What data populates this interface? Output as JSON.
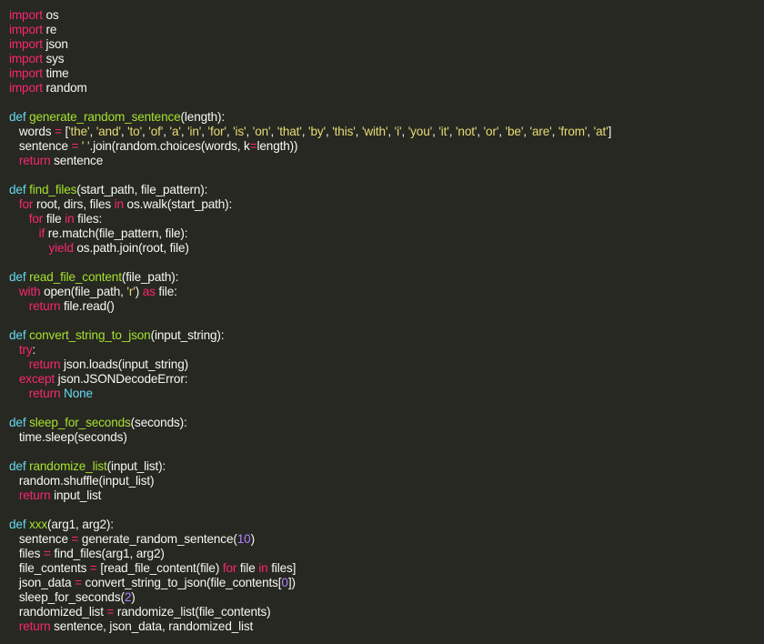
{
  "editor": {
    "theme_colors": {
      "background": "#272822",
      "text": "#f8f8f2",
      "keyword": "#f92672",
      "definition": "#66d9ef",
      "function_name": "#a6e22e",
      "string": "#e6db74",
      "number": "#ae81ff"
    },
    "lines": [
      [
        [
          "kw",
          "import"
        ],
        [
          "p",
          " os"
        ]
      ],
      [
        [
          "kw",
          "import"
        ],
        [
          "p",
          " re"
        ]
      ],
      [
        [
          "kw",
          "import"
        ],
        [
          "p",
          " json"
        ]
      ],
      [
        [
          "kw",
          "import"
        ],
        [
          "p",
          " sys"
        ]
      ],
      [
        [
          "kw",
          "import"
        ],
        [
          "p",
          " time"
        ]
      ],
      [
        [
          "kw",
          "import"
        ],
        [
          "p",
          " random"
        ]
      ],
      [],
      [
        [
          "def",
          "def"
        ],
        [
          "p",
          " "
        ],
        [
          "fn",
          "generate_random_sentence"
        ],
        [
          "p",
          "(length):"
        ]
      ],
      [
        [
          "p",
          "   words "
        ],
        [
          "kw",
          "="
        ],
        [
          "p",
          " ["
        ],
        [
          "str",
          "'the'"
        ],
        [
          "p",
          ", "
        ],
        [
          "str",
          "'and'"
        ],
        [
          "p",
          ", "
        ],
        [
          "str",
          "'to'"
        ],
        [
          "p",
          ", "
        ],
        [
          "str",
          "'of'"
        ],
        [
          "p",
          ", "
        ],
        [
          "str",
          "'a'"
        ],
        [
          "p",
          ", "
        ],
        [
          "str",
          "'in'"
        ],
        [
          "p",
          ", "
        ],
        [
          "str",
          "'for'"
        ],
        [
          "p",
          ", "
        ],
        [
          "str",
          "'is'"
        ],
        [
          "p",
          ", "
        ],
        [
          "str",
          "'on'"
        ],
        [
          "p",
          ", "
        ],
        [
          "str",
          "'that'"
        ],
        [
          "p",
          ", "
        ],
        [
          "str",
          "'by'"
        ],
        [
          "p",
          ", "
        ],
        [
          "str",
          "'this'"
        ],
        [
          "p",
          ", "
        ],
        [
          "str",
          "'with'"
        ],
        [
          "p",
          ", "
        ],
        [
          "str",
          "'i'"
        ],
        [
          "p",
          ", "
        ],
        [
          "str",
          "'you'"
        ],
        [
          "p",
          ", "
        ],
        [
          "str",
          "'it'"
        ],
        [
          "p",
          ", "
        ],
        [
          "str",
          "'not'"
        ],
        [
          "p",
          ", "
        ],
        [
          "str",
          "'or'"
        ],
        [
          "p",
          ", "
        ],
        [
          "str",
          "'be'"
        ],
        [
          "p",
          ", "
        ],
        [
          "str",
          "'are'"
        ],
        [
          "p",
          ", "
        ],
        [
          "str",
          "'from'"
        ],
        [
          "p",
          ", "
        ],
        [
          "str",
          "'at'"
        ],
        [
          "p",
          "]"
        ]
      ],
      [
        [
          "p",
          "   sentence "
        ],
        [
          "kw",
          "="
        ],
        [
          "p",
          " "
        ],
        [
          "str",
          "' '"
        ],
        [
          "p",
          "."
        ],
        [
          "p",
          "join(random"
        ],
        [
          "p",
          "."
        ],
        [
          "p",
          "choices(words, k"
        ],
        [
          "kw",
          "="
        ],
        [
          "p",
          "length))"
        ]
      ],
      [
        [
          "p",
          "   "
        ],
        [
          "kw",
          "return"
        ],
        [
          "p",
          " sentence"
        ]
      ],
      [],
      [
        [
          "def",
          "def"
        ],
        [
          "p",
          " "
        ],
        [
          "fn",
          "find_files"
        ],
        [
          "p",
          "(start_path, file_pattern):"
        ]
      ],
      [
        [
          "p",
          "   "
        ],
        [
          "kw",
          "for"
        ],
        [
          "p",
          " root, dirs, files "
        ],
        [
          "kw",
          "in"
        ],
        [
          "p",
          " os"
        ],
        [
          "p",
          "."
        ],
        [
          "p",
          "walk(start_path):"
        ]
      ],
      [
        [
          "p",
          "      "
        ],
        [
          "kw",
          "for"
        ],
        [
          "p",
          " file "
        ],
        [
          "kw",
          "in"
        ],
        [
          "p",
          " files:"
        ]
      ],
      [
        [
          "p",
          "         "
        ],
        [
          "kw",
          "if"
        ],
        [
          "p",
          " re"
        ],
        [
          "p",
          "."
        ],
        [
          "p",
          "match(file_pattern, file):"
        ]
      ],
      [
        [
          "p",
          "            "
        ],
        [
          "kw",
          "yield"
        ],
        [
          "p",
          " os"
        ],
        [
          "p",
          "."
        ],
        [
          "p",
          "path"
        ],
        [
          "p",
          "."
        ],
        [
          "p",
          "join(root, file)"
        ]
      ],
      [],
      [
        [
          "def",
          "def"
        ],
        [
          "p",
          " "
        ],
        [
          "fn",
          "read_file_content"
        ],
        [
          "p",
          "(file_path):"
        ]
      ],
      [
        [
          "p",
          "   "
        ],
        [
          "kw",
          "with"
        ],
        [
          "p",
          " open(file_path, "
        ],
        [
          "str",
          "'r'"
        ],
        [
          "p",
          ") "
        ],
        [
          "kw",
          "as"
        ],
        [
          "p",
          " file:"
        ]
      ],
      [
        [
          "p",
          "      "
        ],
        [
          "kw",
          "return"
        ],
        [
          "p",
          " file"
        ],
        [
          "p",
          "."
        ],
        [
          "p",
          "read()"
        ]
      ],
      [],
      [
        [
          "def",
          "def"
        ],
        [
          "p",
          " "
        ],
        [
          "fn",
          "convert_string_to_json"
        ],
        [
          "p",
          "(input_string):"
        ]
      ],
      [
        [
          "p",
          "   "
        ],
        [
          "kw",
          "try"
        ],
        [
          "p",
          ":"
        ]
      ],
      [
        [
          "p",
          "      "
        ],
        [
          "kw",
          "return"
        ],
        [
          "p",
          " json"
        ],
        [
          "p",
          "."
        ],
        [
          "p",
          "loads(input_string)"
        ]
      ],
      [
        [
          "p",
          "   "
        ],
        [
          "kw",
          "except"
        ],
        [
          "p",
          " json"
        ],
        [
          "p",
          "."
        ],
        [
          "p",
          "JSONDecodeError:"
        ]
      ],
      [
        [
          "p",
          "      "
        ],
        [
          "kw",
          "return"
        ],
        [
          "p",
          " "
        ],
        [
          "def",
          "None"
        ]
      ],
      [],
      [
        [
          "def",
          "def"
        ],
        [
          "p",
          " "
        ],
        [
          "fn",
          "sleep_for_seconds"
        ],
        [
          "p",
          "(seconds):"
        ]
      ],
      [
        [
          "p",
          "   time"
        ],
        [
          "p",
          "."
        ],
        [
          "p",
          "sleep(seconds)"
        ]
      ],
      [],
      [
        [
          "def",
          "def"
        ],
        [
          "p",
          " "
        ],
        [
          "fn",
          "randomize_list"
        ],
        [
          "p",
          "(input_list):"
        ]
      ],
      [
        [
          "p",
          "   random"
        ],
        [
          "p",
          "."
        ],
        [
          "p",
          "shuffle(input_list)"
        ]
      ],
      [
        [
          "p",
          "   "
        ],
        [
          "kw",
          "return"
        ],
        [
          "p",
          " input_list"
        ]
      ],
      [],
      [
        [
          "def",
          "def"
        ],
        [
          "p",
          " "
        ],
        [
          "fn",
          "xxx"
        ],
        [
          "p",
          "(arg1, arg2):"
        ]
      ],
      [
        [
          "p",
          "   sentence "
        ],
        [
          "kw",
          "="
        ],
        [
          "p",
          " generate_random_sentence("
        ],
        [
          "num",
          "10"
        ],
        [
          "p",
          ")"
        ]
      ],
      [
        [
          "p",
          "   files "
        ],
        [
          "kw",
          "="
        ],
        [
          "p",
          " find_files(arg1, arg2)"
        ]
      ],
      [
        [
          "p",
          "   file_contents "
        ],
        [
          "kw",
          "="
        ],
        [
          "p",
          " [read_file_content(file) "
        ],
        [
          "kw",
          "for"
        ],
        [
          "p",
          " file "
        ],
        [
          "kw",
          "in"
        ],
        [
          "p",
          " files]"
        ]
      ],
      [
        [
          "p",
          "   json_data "
        ],
        [
          "kw",
          "="
        ],
        [
          "p",
          " convert_string_to_json(file_contents["
        ],
        [
          "num",
          "0"
        ],
        [
          "p",
          "])"
        ]
      ],
      [
        [
          "p",
          "   sleep_for_seconds("
        ],
        [
          "num",
          "2"
        ],
        [
          "p",
          ")"
        ]
      ],
      [
        [
          "p",
          "   randomized_list "
        ],
        [
          "kw",
          "="
        ],
        [
          "p",
          " randomize_list(file_contents)"
        ]
      ],
      [
        [
          "p",
          "   "
        ],
        [
          "kw",
          "return"
        ],
        [
          "p",
          " sentence, json_data, randomized_list"
        ]
      ]
    ]
  }
}
